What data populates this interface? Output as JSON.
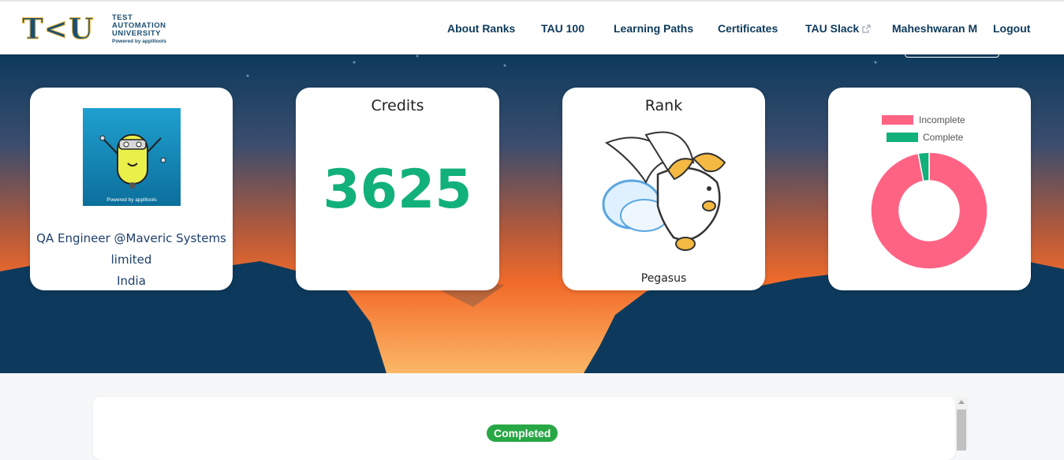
{
  "brand": {
    "logo_mark": "T<U",
    "logo_line1": "TEST",
    "logo_line2": "AUTOMATION",
    "logo_line3": "UNIVERSITY",
    "logo_powered": "Powered by applitools"
  },
  "nav": {
    "items": [
      {
        "label": "About Ranks"
      },
      {
        "label": "TAU 100"
      },
      {
        "label": "Learning Paths"
      },
      {
        "label": "Certificates"
      },
      {
        "label": "TAU Slack",
        "icon": "external-link-icon"
      },
      {
        "label": "Maheshwaran M"
      },
      {
        "label": "Logout"
      }
    ]
  },
  "profile": {
    "avatar_powered": "Powered by applitools",
    "title_line1": "QA Engineer @Maveric Systems",
    "title_line2": "limited",
    "country": "India"
  },
  "credits": {
    "title": "Credits",
    "value": "3625"
  },
  "rank": {
    "title": "Rank",
    "name": "Pegasus",
    "image_icon": "pegasus-icon"
  },
  "progress": {
    "legend": [
      {
        "label": "Incomplete",
        "color": "#ff6384"
      },
      {
        "label": "Complete",
        "color": "#12b07a"
      }
    ]
  },
  "chart_data": {
    "type": "pie",
    "variant": "doughnut",
    "categories": [
      "Incomplete",
      "Complete"
    ],
    "values": [
      97,
      3
    ],
    "colors": [
      "#ff6384",
      "#12b07a"
    ],
    "legend_position": "top"
  },
  "course_panel": {
    "status_badge": "Completed"
  },
  "colors": {
    "nav_text": "#0d3a5c",
    "credits": "#12b07a",
    "badge": "#28a745",
    "sky_top": "#0d3a5c",
    "sunset": "#f26b2a"
  }
}
